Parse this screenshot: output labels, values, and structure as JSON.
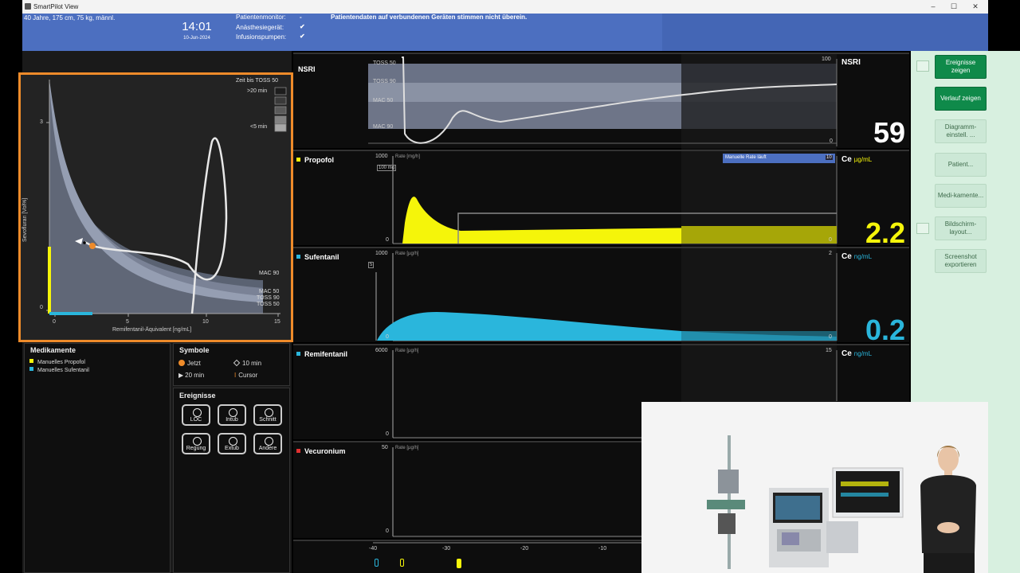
{
  "window": {
    "title": "SmartPilot View",
    "controls": [
      "–",
      "☐",
      "✕"
    ]
  },
  "header": {
    "patient": "40 Jahre, 175 cm, 75 kg, männl.",
    "time": "14:01",
    "date": "10-Jun-2024",
    "devices": [
      {
        "label": "Patientenmonitor:",
        "value": "-"
      },
      {
        "label": "Anästhesiegerät:",
        "value": "✔"
      },
      {
        "label": "Infusionspumpen:",
        "value": "✔"
      }
    ],
    "warning": "Patientendaten auf verbundenen Geräten stimmen nicht überein."
  },
  "topography": {
    "ylabel": "Sevofluran [Vol%]",
    "xlabel": "Remifentanil-Äquivalent [ng/mL]",
    "yticks": [
      "3",
      "0"
    ],
    "xticks": [
      "0",
      "5",
      "10",
      "15"
    ],
    "legend_title": "Zeit bis TOSS 50",
    "legend_top": ">20 min",
    "legend_bottom": "<5 min",
    "band_labels": [
      "MAC 90",
      "MAC 50",
      "TOSS 90",
      "TOSS 50"
    ]
  },
  "colors": {
    "propofol": "#f5f50a",
    "sufentanil": "#2ab6dc",
    "remifentanil": "#2ab6dc",
    "vecuronium": "#e03030",
    "accent": "#ee8b2a",
    "header": "#4c6fc0",
    "active_button": "#0f8a4a"
  },
  "medications": {
    "title": "Medikamente",
    "items": [
      {
        "label": "Manuelles Propofol",
        "color": "#f5f50a"
      },
      {
        "label": "Manuelles Sufentanil",
        "color": "#2ab6dc"
      }
    ]
  },
  "symbols": {
    "title": "Symbole",
    "items": [
      "Jetzt",
      "10 min",
      "20 min",
      "Cursor"
    ]
  },
  "events": {
    "title": "Ereignisse",
    "buttons": [
      "LOC",
      "Intub",
      "Schnitt",
      "Regung",
      "Extub",
      "Andere"
    ]
  },
  "tracks": {
    "nsri": {
      "name": "NSRI",
      "scale_top": "100",
      "scale_bottom": "0",
      "bands": [
        "TOSS 50",
        "TOSS 90",
        "MAC 50",
        "MAC 90"
      ],
      "value_label": "NSRI",
      "value": "59"
    },
    "propofol": {
      "name": "Propofol",
      "scale_top": "1000",
      "scale_bottom": "0",
      "rate_label": "Rate [mg/h]",
      "bolus_label": "100 mg",
      "badge": "Manuelle Rate läuft",
      "badge_value": "10",
      "right_scale_bottom": "0",
      "ce_label": "Ce",
      "unit": "µg/mL",
      "value": "2.2"
    },
    "sufentanil": {
      "name": "Sufentanil",
      "scale_top": "1000",
      "scale_bottom": "0",
      "rate_label": "Rate [µg/h]",
      "bolus_label": "5",
      "right_scale_top": "2",
      "right_scale_bottom": "0",
      "ce_label": "Ce",
      "unit": "ng/mL",
      "value": "0.2"
    },
    "remifentanil": {
      "name": "Remifentanil",
      "scale_top": "6000",
      "scale_bottom": "0",
      "rate_label": "Rate [µg/h]",
      "right_scale_top": "15",
      "ce_label": "Ce",
      "unit": "ng/mL"
    },
    "vecuronium": {
      "name": "Vecuronium",
      "scale_top": "50",
      "scale_bottom": "0",
      "rate_label": "Rate [µg/h]"
    }
  },
  "timeaxis": [
    "-40",
    "-30",
    "-20",
    "-10"
  ],
  "buttons": [
    {
      "label": "Ereignisse zeigen",
      "active": true
    },
    {
      "label": "Verlauf zeigen",
      "active": true
    },
    {
      "label": "Diagramm-einstell. ...",
      "active": false
    },
    {
      "label": "Patient...",
      "active": false
    },
    {
      "label": "Medi-kamente...",
      "active": false
    },
    {
      "label": "Bildschirm-layout...",
      "active": false
    },
    {
      "label": "Screenshot exportieren",
      "active": false
    }
  ]
}
